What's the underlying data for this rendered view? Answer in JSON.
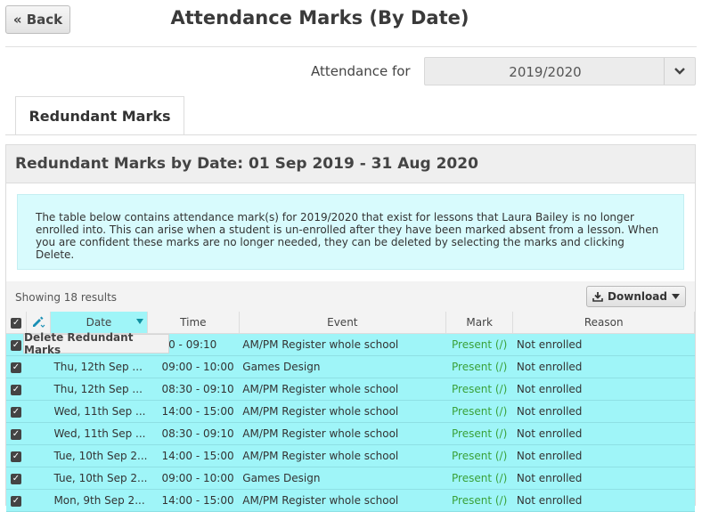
{
  "header": {
    "back_label": "« Back",
    "title": "Attendance Marks (By Date)"
  },
  "filter": {
    "label": "Attendance for",
    "value": "2019/2020"
  },
  "tabs": [
    {
      "label": "Redundant Marks"
    }
  ],
  "panel": {
    "title": "Redundant Marks by Date: 01 Sep 2019 - 31 Aug 2020",
    "info": "The table below contains attendance mark(s) for 2019/2020 that exist for lessons that Laura Bailey is no longer enrolled into. This can arise when a student is un-enrolled after they have been marked absent from a lesson. When you are confident these marks are no longer needed, they can be deleted by selecting the marks and clicking Delete.",
    "showing": "Showing 18 results",
    "download_label": "Download",
    "tooltip": "Delete Redundant Marks"
  },
  "table": {
    "columns": [
      "Date",
      "Time",
      "Event",
      "Mark",
      "Reason"
    ],
    "rows": [
      {
        "date": "",
        "time": "30 - 09:10",
        "event": "AM/PM Register whole school",
        "mark": "Present (/)",
        "reason": "Not enrolled"
      },
      {
        "date": "Thu, 12th Sep ...",
        "time": "09:00 - 10:00",
        "event": "Games Design",
        "mark": "Present (/)",
        "reason": "Not enrolled"
      },
      {
        "date": "Thu, 12th Sep ...",
        "time": "08:30 - 09:10",
        "event": "AM/PM Register whole school",
        "mark": "Present (/)",
        "reason": "Not enrolled"
      },
      {
        "date": "Wed, 11th Sep ...",
        "time": "14:00 - 15:00",
        "event": "AM/PM Register whole school",
        "mark": "Present (/)",
        "reason": "Not enrolled"
      },
      {
        "date": "Wed, 11th Sep ...",
        "time": "08:30 - 09:10",
        "event": "AM/PM Register whole school",
        "mark": "Present (/)",
        "reason": "Not enrolled"
      },
      {
        "date": "Tue, 10th Sep 2...",
        "time": "14:00 - 15:00",
        "event": "AM/PM Register whole school",
        "mark": "Present (/)",
        "reason": "Not enrolled"
      },
      {
        "date": "Tue, 10th Sep 2...",
        "time": "09:00 - 10:00",
        "event": "Games Design",
        "mark": "Present (/)",
        "reason": "Not enrolled"
      },
      {
        "date": "Mon, 9th Sep 2...",
        "time": "14:00 - 15:00",
        "event": "AM/PM Register whole school",
        "mark": "Present (/)",
        "reason": "Not enrolled"
      }
    ]
  }
}
